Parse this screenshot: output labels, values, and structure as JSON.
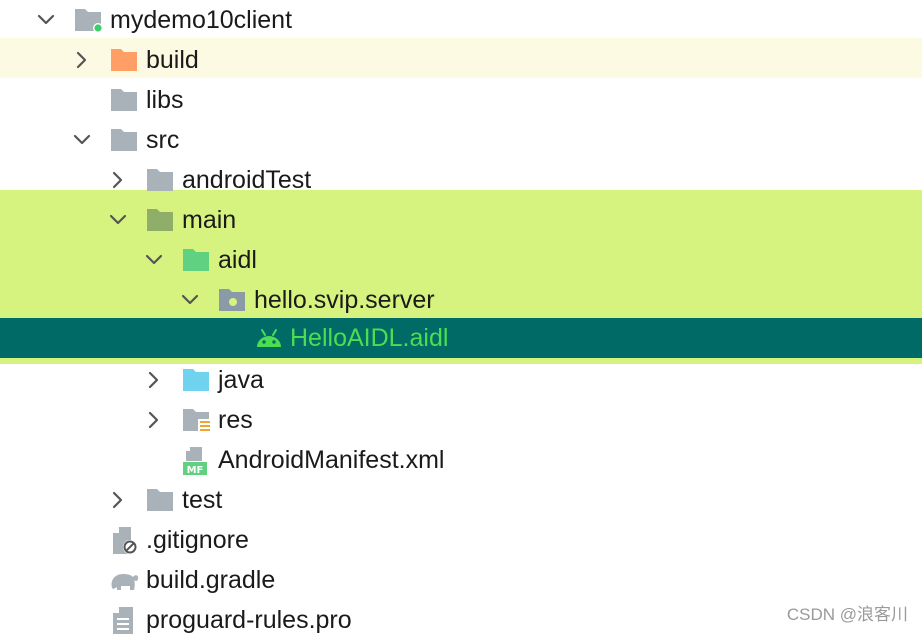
{
  "colors": {
    "folder_gray": "#a9b1b9",
    "folder_orange": "#ff9f66",
    "folder_source_green": "#8fae6a",
    "folder_aidl_green": "#5fd180",
    "folder_java_blue": "#6fd3f0",
    "selection_bg": "#006b66",
    "selected_text": "#4ade50",
    "highlight_green": "#d6f37f",
    "highlight_yellow": "#fdfae3"
  },
  "tree": {
    "items": [
      {
        "label": "mydemo10client",
        "icon": "module-folder-icon",
        "expanded": true
      },
      {
        "label": "build",
        "icon": "excluded-folder-icon",
        "expanded": false
      },
      {
        "label": "libs",
        "icon": "folder-icon"
      },
      {
        "label": "src",
        "icon": "folder-icon",
        "expanded": true
      },
      {
        "label": "androidTest",
        "icon": "folder-icon",
        "expanded": false
      },
      {
        "label": "main",
        "icon": "source-folder-icon",
        "expanded": true
      },
      {
        "label": "aidl",
        "icon": "aidl-folder-icon",
        "expanded": true
      },
      {
        "label": "hello.svip.server",
        "icon": "package-icon",
        "expanded": true
      },
      {
        "label": "HelloAIDL.aidl",
        "icon": "android-icon",
        "selected": true
      },
      {
        "label": "java",
        "icon": "java-folder-icon",
        "expanded": false
      },
      {
        "label": "res",
        "icon": "resource-folder-icon",
        "expanded": false
      },
      {
        "label": "AndroidManifest.xml",
        "icon": "manifest-file-icon"
      },
      {
        "label": "test",
        "icon": "folder-icon",
        "expanded": false
      },
      {
        "label": ".gitignore",
        "icon": "ignored-file-icon"
      },
      {
        "label": "build.gradle",
        "icon": "gradle-elephant-icon"
      },
      {
        "label": "proguard-rules.pro",
        "icon": "text-file-icon"
      }
    ]
  },
  "watermark": "CSDN @浪客川"
}
